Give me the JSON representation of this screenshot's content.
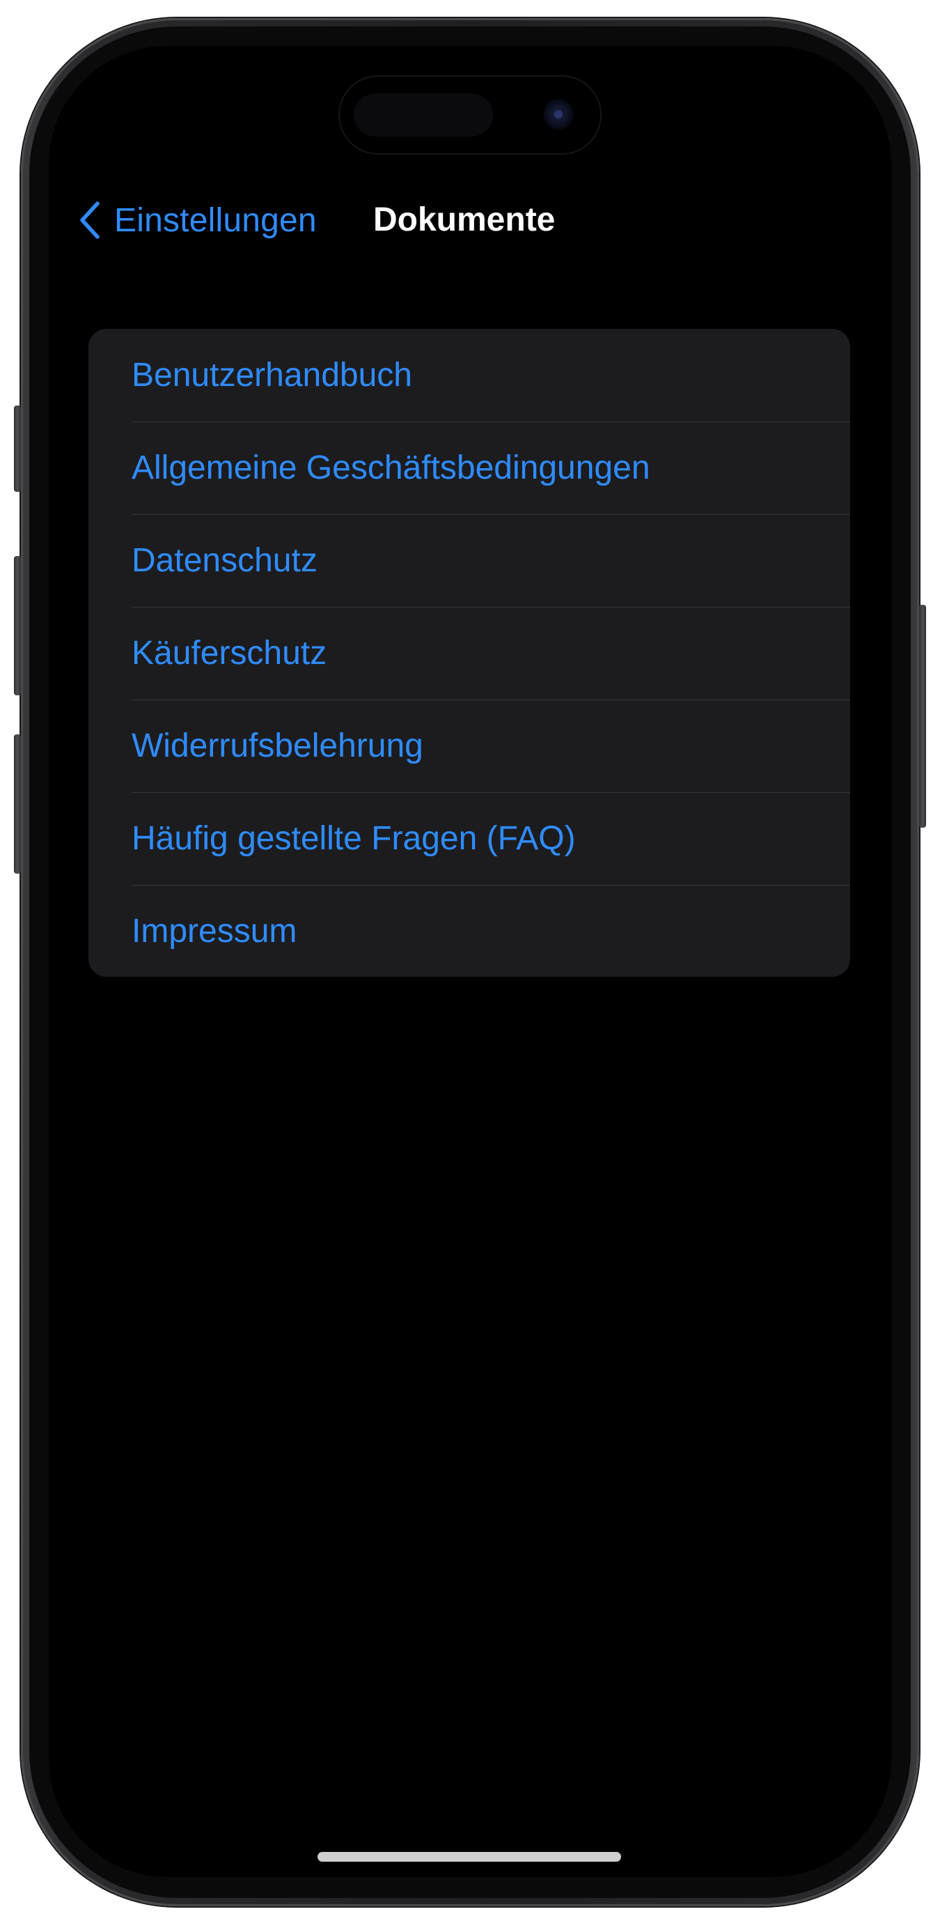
{
  "navbar": {
    "back_label": "Einstellungen",
    "title": "Dokumente"
  },
  "documents": {
    "items": [
      {
        "label": "Benutzerhandbuch"
      },
      {
        "label": "Allgemeine Geschäftsbedingungen"
      },
      {
        "label": "Datenschutz"
      },
      {
        "label": "Käuferschutz"
      },
      {
        "label": "Widerrufsbelehrung"
      },
      {
        "label": "Häufig gestellte Fragen (FAQ)"
      },
      {
        "label": "Impressum"
      }
    ]
  },
  "theme": {
    "accent": "#2f8cff",
    "background": "#000000",
    "group_background": "#1c1c1e",
    "separator": "#38383a",
    "title_color": "#ffffff"
  },
  "icons": {
    "back": "chevron-left-icon"
  }
}
